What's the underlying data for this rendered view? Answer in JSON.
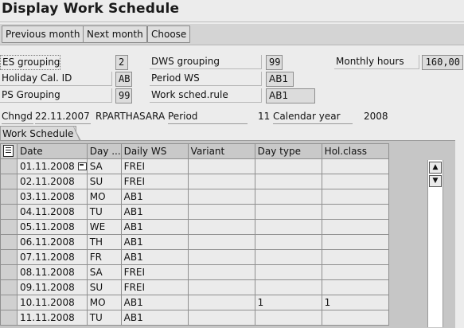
{
  "title": "Display Work Schedule",
  "toolbar": {
    "previous_month": "Previous month",
    "next_month": "Next month",
    "choose": "Choose"
  },
  "header": {
    "es_grouping_label": "ES grouping",
    "es_grouping_value": "2",
    "holiday_cal_label": "Holiday Cal. ID",
    "holiday_cal_value": "AB",
    "ps_grouping_label": "PS Grouping",
    "ps_grouping_value": "99",
    "dws_grouping_label": "DWS grouping",
    "dws_grouping_value": "99",
    "period_ws_label": "Period WS",
    "period_ws_value": "AB1",
    "work_sched_rule_label": "Work sched.rule",
    "work_sched_rule_value": "AB1",
    "monthly_hours_label": "Monthly hours",
    "monthly_hours_value": "160,00",
    "changed_label": "Chngd",
    "changed_date": "22.11.2007",
    "changed_by": "RPARTHASARA",
    "period_label": "Period",
    "period_value": "11",
    "calendar_year_label": "Calendar year",
    "calendar_year_value": "2008"
  },
  "tab": {
    "label": "Work Schedule"
  },
  "table": {
    "columns": [
      "Date",
      "Day ...",
      "Daily WS",
      "Variant",
      "Day type",
      "Hol.class"
    ],
    "rows": [
      [
        "01.11.2008",
        "SA",
        "FREI",
        "",
        "",
        ""
      ],
      [
        "02.11.2008",
        "SU",
        "FREI",
        "",
        "",
        ""
      ],
      [
        "03.11.2008",
        "MO",
        "AB1",
        "",
        "",
        ""
      ],
      [
        "04.11.2008",
        "TU",
        "AB1",
        "",
        "",
        ""
      ],
      [
        "05.11.2008",
        "WE",
        "AB1",
        "",
        "",
        ""
      ],
      [
        "06.11.2008",
        "TH",
        "AB1",
        "",
        "",
        ""
      ],
      [
        "07.11.2008",
        "FR",
        "AB1",
        "",
        "",
        ""
      ],
      [
        "08.11.2008",
        "SA",
        "FREI",
        "",
        "",
        ""
      ],
      [
        "09.11.2008",
        "SU",
        "FREI",
        "",
        "",
        ""
      ],
      [
        "10.11.2008",
        "MO",
        "AB1",
        "",
        "1",
        "1"
      ],
      [
        "11.11.2008",
        "TU",
        "AB1",
        "",
        "",
        ""
      ]
    ]
  },
  "icons": {
    "select_all": "select-all-icon",
    "calendar": "calendar-icon",
    "scroll_up": "arrow-up-icon",
    "scroll_down": "arrow-down-icon"
  }
}
